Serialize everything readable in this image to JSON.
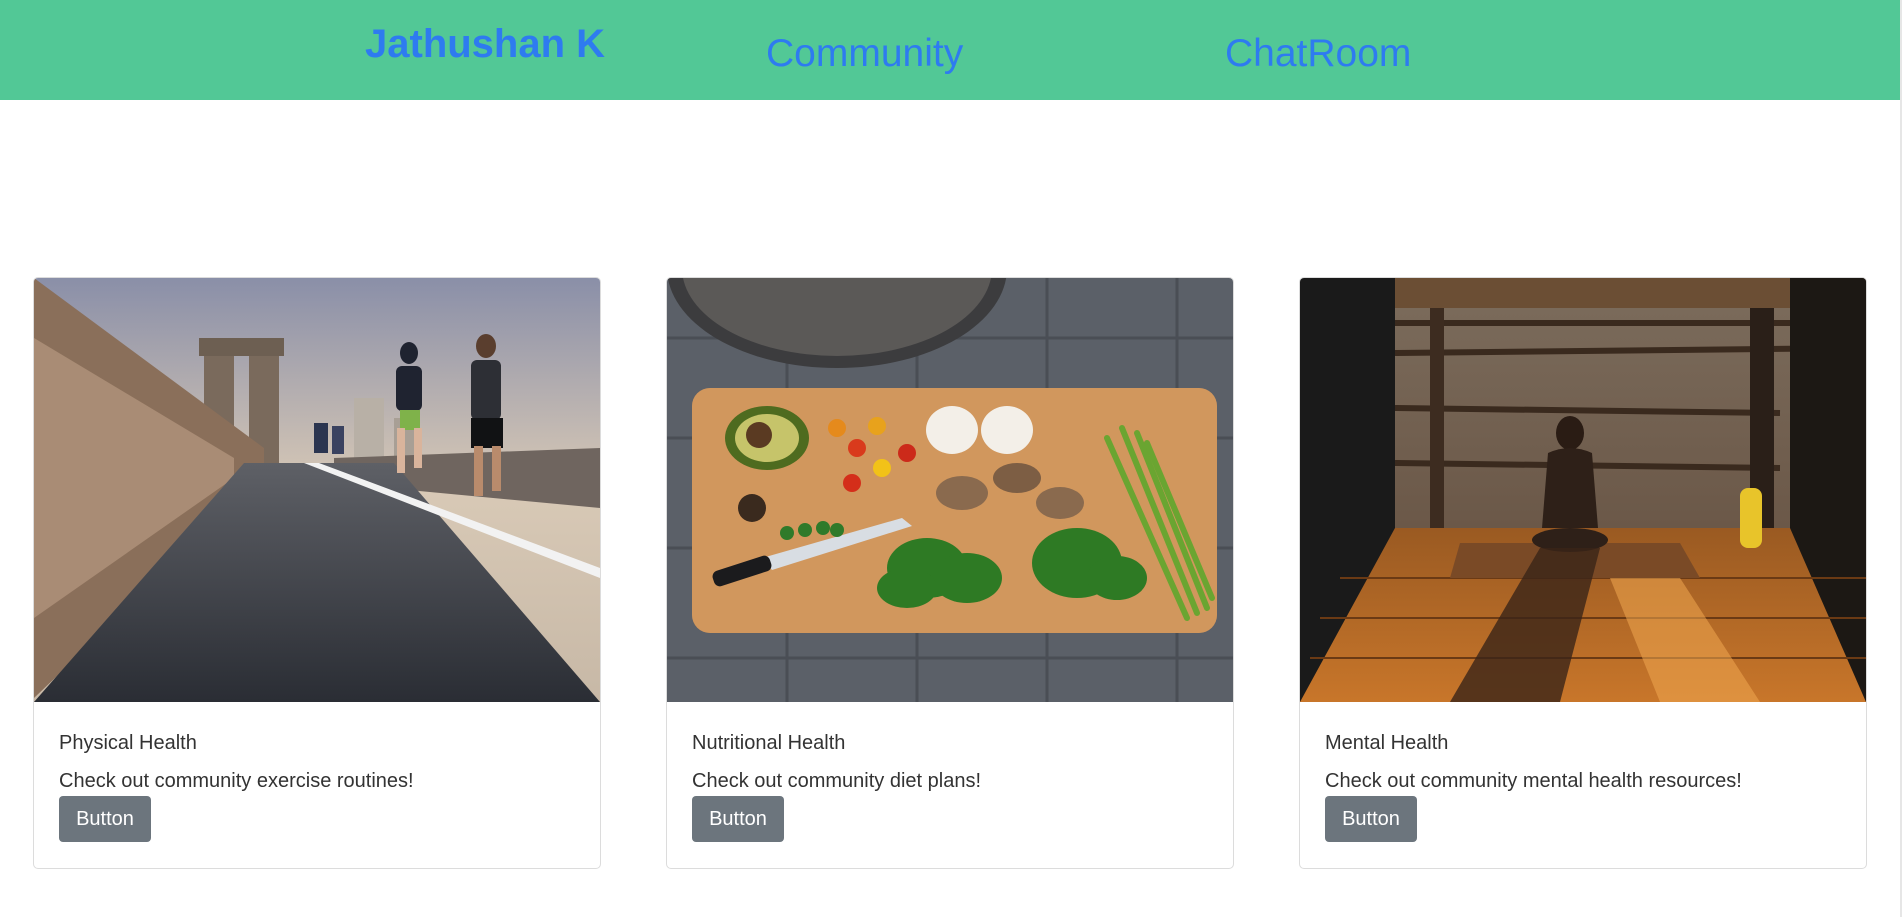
{
  "navbar": {
    "brand": "Jathushan K",
    "links": [
      {
        "label": "Community"
      },
      {
        "label": "ChatRoom"
      }
    ],
    "background": "#52c896",
    "link_color": "#2e7bf0"
  },
  "cards": [
    {
      "image": "people-jogging-on-bridge-photo",
      "title": "Physical Health",
      "text": "Check out community exercise routines!",
      "button_label": "Button"
    },
    {
      "image": "vegetables-on-cutting-board-photo",
      "title": "Nutritional Health",
      "text": "Check out community diet plans!",
      "button_label": "Button"
    },
    {
      "image": "person-meditating-at-sunset-photo",
      "title": "Mental Health",
      "text": "Check out community mental health resources!",
      "button_label": "Button"
    }
  ],
  "button_color": "#6c757d"
}
